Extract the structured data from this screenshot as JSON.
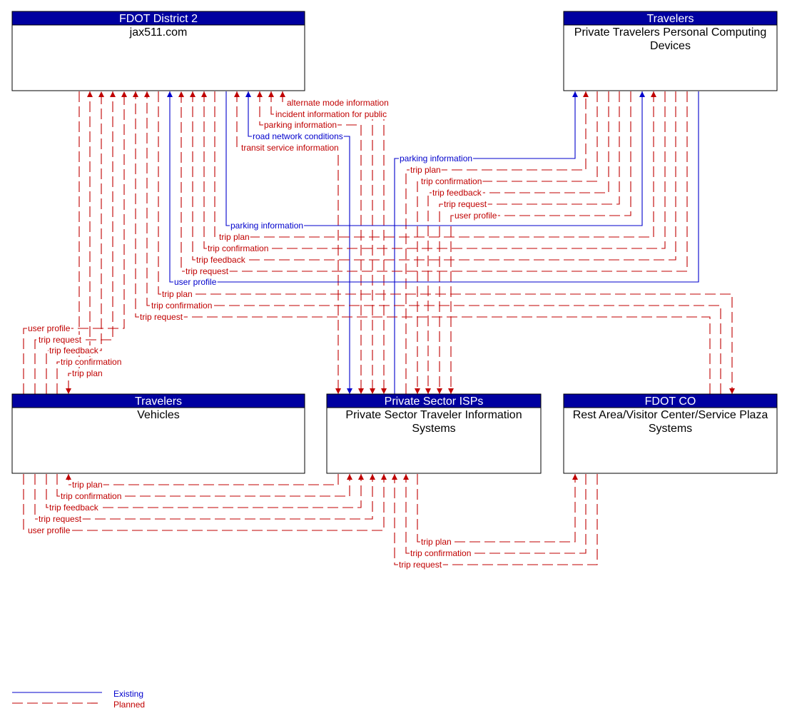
{
  "colors": {
    "existing": "#0000CC",
    "planned": "#C00000",
    "header_fill": "#0000A0"
  },
  "elements": [
    {
      "id": "jax511",
      "stakeholder": "FDOT District 2",
      "name_lines": [
        "jax511.com"
      ]
    },
    {
      "id": "ptpcd",
      "stakeholder": "Travelers",
      "name_lines": [
        "Private Travelers Personal Computing",
        "Devices"
      ]
    },
    {
      "id": "vehicles",
      "stakeholder": "Travelers",
      "name_lines": [
        "Vehicles"
      ]
    },
    {
      "id": "isp",
      "stakeholder": "Private Sector ISPs",
      "name_lines": [
        "Private Sector Traveler Information",
        "Systems"
      ]
    },
    {
      "id": "rest_area",
      "stakeholder": "FDOT CO",
      "name_lines": [
        "Rest Area/Visitor Center/Service Plaza",
        "Systems"
      ]
    }
  ],
  "flows": [
    {
      "label": "alternate mode information",
      "status": "planned",
      "source": "jax511",
      "destination": "isp"
    },
    {
      "label": "incident information for public",
      "status": "planned",
      "source": "jax511",
      "destination": "isp"
    },
    {
      "label": "parking information",
      "status": "planned",
      "source": "jax511",
      "destination": "isp"
    },
    {
      "label": "road network conditions",
      "status": "existing",
      "source": "jax511",
      "destination": "isp"
    },
    {
      "label": "transit service information",
      "status": "planned",
      "source": "jax511",
      "destination": "isp"
    },
    {
      "label": "parking information",
      "status": "existing",
      "source": "isp",
      "destination": "ptpcd"
    },
    {
      "label": "trip plan",
      "status": "planned",
      "source": "isp",
      "destination": "ptpcd"
    },
    {
      "label": "trip confirmation",
      "status": "planned",
      "source": "ptpcd",
      "destination": "isp"
    },
    {
      "label": "trip feedback",
      "status": "planned",
      "source": "ptpcd",
      "destination": "isp"
    },
    {
      "label": "trip request",
      "status": "planned",
      "source": "ptpcd",
      "destination": "isp"
    },
    {
      "label": "user profile",
      "status": "planned",
      "source": "ptpcd",
      "destination": "isp"
    },
    {
      "label": "parking information",
      "status": "existing",
      "source": "jax511",
      "destination": "ptpcd"
    },
    {
      "label": "trip plan",
      "status": "planned",
      "source": "jax511",
      "destination": "ptpcd"
    },
    {
      "label": "trip confirmation",
      "status": "planned",
      "source": "ptpcd",
      "destination": "jax511"
    },
    {
      "label": "trip feedback",
      "status": "planned",
      "source": "ptpcd",
      "destination": "jax511"
    },
    {
      "label": "trip request",
      "status": "planned",
      "source": "ptpcd",
      "destination": "jax511"
    },
    {
      "label": "user profile",
      "status": "existing",
      "source": "ptpcd",
      "destination": "jax511"
    },
    {
      "label": "trip plan",
      "status": "planned",
      "source": "jax511",
      "destination": "rest_area"
    },
    {
      "label": "trip confirmation",
      "status": "planned",
      "source": "rest_area",
      "destination": "jax511"
    },
    {
      "label": "trip request",
      "status": "planned",
      "source": "rest_area",
      "destination": "jax511"
    },
    {
      "label": "user profile",
      "status": "planned",
      "source": "vehicles",
      "destination": "jax511"
    },
    {
      "label": "trip request",
      "status": "planned",
      "source": "vehicles",
      "destination": "jax511"
    },
    {
      "label": "trip feedback",
      "status": "planned",
      "source": "vehicles",
      "destination": "jax511"
    },
    {
      "label": "trip confirmation",
      "status": "planned",
      "source": "vehicles",
      "destination": "jax511"
    },
    {
      "label": "trip plan",
      "status": "planned",
      "source": "jax511",
      "destination": "vehicles"
    },
    {
      "label": "trip plan",
      "status": "planned",
      "source": "isp",
      "destination": "vehicles"
    },
    {
      "label": "trip confirmation",
      "status": "planned",
      "source": "vehicles",
      "destination": "isp"
    },
    {
      "label": "trip feedback",
      "status": "planned",
      "source": "vehicles",
      "destination": "isp"
    },
    {
      "label": "trip request",
      "status": "planned",
      "source": "vehicles",
      "destination": "isp"
    },
    {
      "label": "user profile",
      "status": "planned",
      "source": "vehicles",
      "destination": "isp"
    },
    {
      "label": "trip plan",
      "status": "planned",
      "source": "isp",
      "destination": "rest_area"
    },
    {
      "label": "trip confirmation",
      "status": "planned",
      "source": "rest_area",
      "destination": "isp"
    },
    {
      "label": "trip request",
      "status": "planned",
      "source": "rest_area",
      "destination": "isp"
    }
  ],
  "legend": [
    {
      "label": "Existing",
      "status": "existing"
    },
    {
      "label": "Planned",
      "status": "planned"
    }
  ]
}
